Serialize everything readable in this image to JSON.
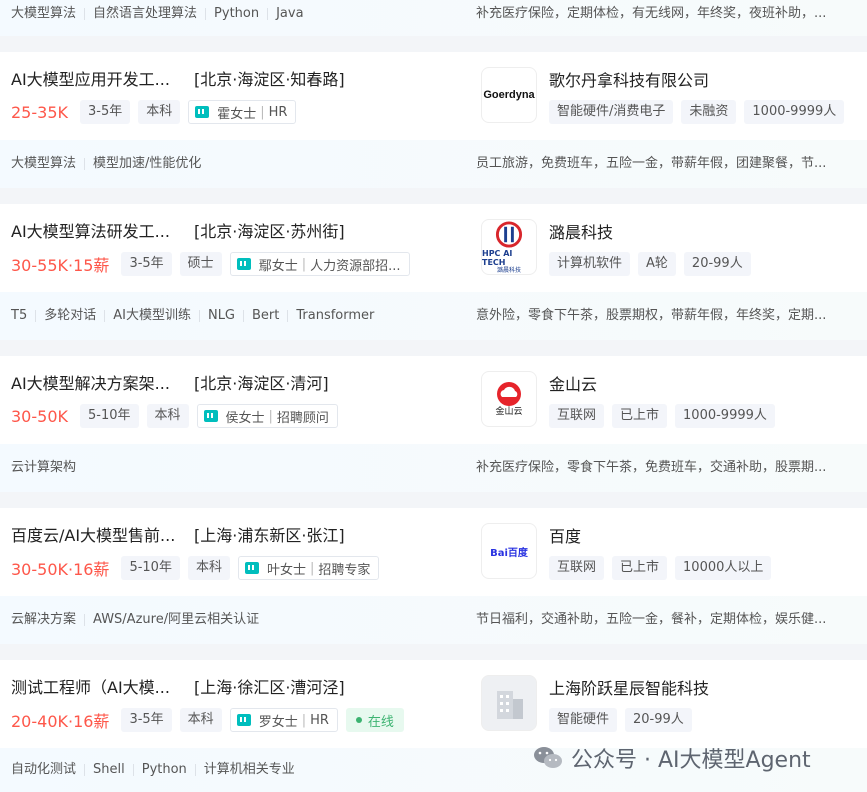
{
  "top_card": {
    "skills": [
      "大模型算法",
      "自然语言处理算法",
      "Python",
      "Java"
    ],
    "benefits": "补充医疗保险，定期体检，有无线网，年终奖，夜班补助，..."
  },
  "jobs": [
    {
      "title": "AI大模型应用开发工...",
      "location": "[北京·海淀区·知春路]",
      "salary": "25-35K",
      "experience": "3-5年",
      "education": "本科",
      "hr_name": "霍女士",
      "hr_title": "HR",
      "online": "",
      "company": "歌尔丹拿科技有限公司",
      "logo_text": "Goerdyna",
      "company_tags": [
        "智能硬件/消费电子",
        "未融资",
        "1000-9999人"
      ],
      "skills": [
        "大模型算法",
        "模型加速/性能优化"
      ],
      "benefits": "员工旅游，免费班车，五险一金，带薪年假，团建聚餐，节..."
    },
    {
      "title": "AI大模型算法研发工...",
      "location": "[北京·海淀区·苏州街]",
      "salary": "30-55K·15薪",
      "experience": "3-5年",
      "education": "硕士",
      "hr_name": "鄢女士",
      "hr_title": "人力资源部招...",
      "online": "",
      "company": "潞晨科技",
      "logo_text": "HPC AI TECH",
      "logo_subtext": "潞晨科技",
      "company_tags": [
        "计算机软件",
        "A轮",
        "20-99人"
      ],
      "skills": [
        "T5",
        "多轮对话",
        "AI大模型训练",
        "NLG",
        "Bert",
        "Transformer"
      ],
      "benefits": "意外险，零食下午茶，股票期权，带薪年假，年终奖，定期..."
    },
    {
      "title": "AI大模型解决方案架...",
      "location": "[北京·海淀区·清河]",
      "salary": "30-50K",
      "experience": "5-10年",
      "education": "本科",
      "hr_name": "侯女士",
      "hr_title": "招聘顾问",
      "online": "",
      "company": "金山云",
      "logo_text": "金山云",
      "company_tags": [
        "互联网",
        "已上市",
        "1000-9999人"
      ],
      "skills": [
        "云计算架构"
      ],
      "benefits": "补充医疗保险，零食下午茶，免费班车，交通补助，股票期..."
    },
    {
      "title": "百度云/AI大模型售前...",
      "location": "[上海·浦东新区·张江]",
      "salary": "30-50K·16薪",
      "experience": "5-10年",
      "education": "本科",
      "hr_name": "叶女士",
      "hr_title": "招聘专家",
      "online": "",
      "company": "百度",
      "logo_text": "Bai百度",
      "company_tags": [
        "互联网",
        "已上市",
        "10000人以上"
      ],
      "skills": [
        "云解决方案",
        "AWS/Azure/阿里云相关认证"
      ],
      "benefits": "节日福利，交通补助，五险一金，餐补，定期体检，娱乐健..."
    },
    {
      "title": "测试工程师（AI大模...",
      "location": "[上海·徐汇区·漕河泾]",
      "salary": "20-40K·16薪",
      "experience": "3-5年",
      "education": "本科",
      "hr_name": "罗女士",
      "hr_title": "HR",
      "online": "在线",
      "company": "上海阶跃星辰智能科技",
      "logo_text": "",
      "company_tags": [
        "智能硬件",
        "20-99人"
      ],
      "skills": [
        "自动化测试",
        "Shell",
        "Python",
        "计算机相关专业"
      ],
      "benefits": ""
    }
  ],
  "watermark": "公众号 · AI大模型Agent",
  "colors": {
    "salary": "#fe574a",
    "hr_chat": "#00bebd",
    "online": "#3cb371"
  }
}
